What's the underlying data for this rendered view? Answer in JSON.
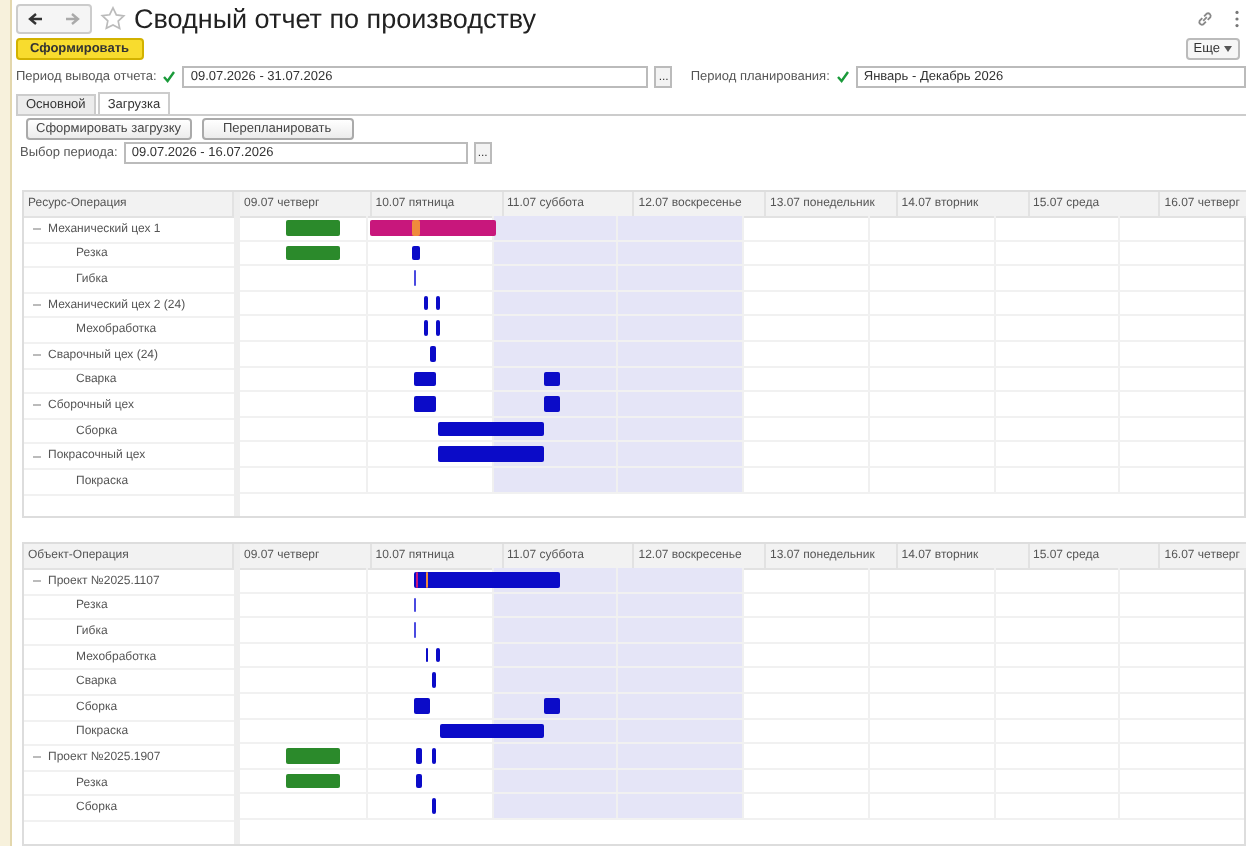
{
  "window": {
    "title": "Сводный отчет по производству"
  },
  "toolbar": {
    "generate_button": "Сформировать",
    "more_button": "Еще"
  },
  "filters": [
    {
      "label": "Период вывода отчета:",
      "checked": true,
      "value": "09.07.2026 - 31.07.2026",
      "picker": "..."
    },
    {
      "label": "Период планирования:",
      "checked": true,
      "value": "Январь - Декабрь 2026"
    }
  ],
  "tabs": [
    {
      "label": "Основной",
      "selected": false
    },
    {
      "label": "Загрузка",
      "selected": true
    }
  ],
  "actions": [
    "Сформировать загрузку",
    "Перепланировать"
  ],
  "period": {
    "label": "Выбор периода:",
    "value": "09.07.2026 - 16.07.2026",
    "picker": "..."
  },
  "gantts": [
    {
      "tree_heading": "Ресурс-Операция",
      "days": [
        {
          "label": "09.07 четверг",
          "weekend": false
        },
        {
          "label": "10.07 пятница",
          "weekend": false
        },
        {
          "label": "11.07 суббота",
          "weekend": true
        },
        {
          "label": "12.07 воскресенье",
          "weekend": true
        },
        {
          "label": "13.07 понедельник",
          "weekend": false
        },
        {
          "label": "14.07 вторник",
          "weekend": false
        },
        {
          "label": "15.07 среда",
          "weekend": false
        },
        {
          "label": "16.07 четверг",
          "weekend": false
        }
      ],
      "rows": [
        {
          "label": "Механический цех 1",
          "expanded": true,
          "children": [
            {
              "label": "Резка"
            },
            {
              "label": "Гибка"
            }
          ]
        },
        {
          "label": "Механический цех 2 (24)",
          "expanded": true,
          "children": [
            {
              "label": "Мехобработка"
            }
          ]
        },
        {
          "label": "Сварочный цех (24)",
          "expanded": true,
          "children": [
            {
              "label": "Сварка"
            }
          ]
        },
        {
          "label": "Сборочный цех",
          "expanded": true,
          "children": [
            {
              "label": "Сборка"
            }
          ]
        },
        {
          "label": "Покрасочный цех",
          "expanded": true,
          "children": [
            {
              "label": "Покраска"
            }
          ]
        }
      ]
    },
    {
      "tree_heading": "Объект-Операция",
      "days": [
        {
          "label": "09.07 четверг",
          "weekend": false
        },
        {
          "label": "10.07 пятница",
          "weekend": false
        },
        {
          "label": "11.07 суббота",
          "weekend": true
        },
        {
          "label": "12.07 воскресенье",
          "weekend": true
        },
        {
          "label": "13.07 понедельник",
          "weekend": false
        },
        {
          "label": "14.07 вторник",
          "weekend": false
        },
        {
          "label": "15.07 среда",
          "weekend": false
        },
        {
          "label": "16.07 четверг",
          "weekend": false
        }
      ],
      "rows": [
        {
          "label": "Проект №2025.1107",
          "expanded": true,
          "children": [
            {
              "label": "Резка"
            },
            {
              "label": "Гибка"
            },
            {
              "label": "Мехобработка"
            },
            {
              "label": "Сварка"
            },
            {
              "label": "Сборка"
            },
            {
              "label": "Покраска"
            }
          ]
        },
        {
          "label": "Проект №2025.1907",
          "expanded": true,
          "children": [
            {
              "label": "Резка"
            },
            {
              "label": "Сборка"
            }
          ]
        }
      ]
    }
  ]
}
